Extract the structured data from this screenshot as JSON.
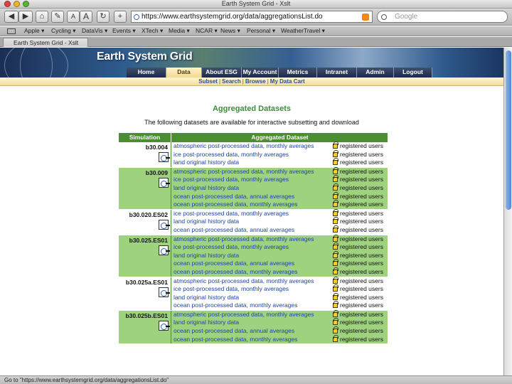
{
  "window": {
    "title": "Earth System Grid - Xslt"
  },
  "toolbar": {
    "back": "◀",
    "forward": "▶",
    "home": "⌂",
    "edit": "✎",
    "font_smaller": "A",
    "font_larger": "A",
    "reload": "↻",
    "add": "+",
    "url": "https://www.earthsystemgrid.org/data/aggregationsList.do",
    "search_placeholder": "Google"
  },
  "bookmarks": [
    "Apple ▾",
    "Cycling ▾",
    "DataVis ▾",
    "Events ▾",
    "XTech ▾",
    "Media ▾",
    "NCAR ▾",
    "News ▾",
    "Personal ▾",
    "WeatherTravel ▾"
  ],
  "tab": {
    "label": "Earth System Grid - Xslt"
  },
  "site": {
    "banner_title": "Earth System Grid",
    "nav": [
      "Home",
      "Data",
      "About ESG",
      "My Account",
      "Metrics",
      "Intranet",
      "Admin",
      "Logout"
    ],
    "active_nav": "Data",
    "subnav": [
      "Subset",
      "Search",
      "Browse",
      "My Data Cart"
    ],
    "subnav_sep": "|"
  },
  "main": {
    "heading": "Aggregated Datasets",
    "intro": "The following datasets are available for interactive subsetting and download",
    "columns": [
      "Simulation",
      "Aggregated Dataset"
    ],
    "rows": [
      {
        "simulation": "b30.004",
        "datasets": [
          {
            "label": "atmospheric post-processed data, monthly averages",
            "access": "registered users"
          },
          {
            "label": "ice post-processed data, monthly averages",
            "access": "registered users"
          },
          {
            "label": "land original history data",
            "access": "registered users"
          }
        ]
      },
      {
        "simulation": "b30.009",
        "datasets": [
          {
            "label": "atmospheric post-processed data, monthly averages",
            "access": "registered users"
          },
          {
            "label": "ice post-processed data, monthly averages",
            "access": "registered users"
          },
          {
            "label": "land original history data",
            "access": "registered users"
          },
          {
            "label": "ocean post-processed data, annual averages",
            "access": "registered users"
          },
          {
            "label": "ocean post-processed data, monthly averages",
            "access": "registered users"
          }
        ]
      },
      {
        "simulation": "b30.020.ES02",
        "datasets": [
          {
            "label": "ice post-processed data, monthly averages",
            "access": "registered users"
          },
          {
            "label": "land original history data",
            "access": "registered users"
          },
          {
            "label": "ocean post-processed data, annual averages",
            "access": "registered users"
          }
        ]
      },
      {
        "simulation": "b30.025.ES01",
        "datasets": [
          {
            "label": "atmospheric post-processed data, monthly averages",
            "access": "registered users"
          },
          {
            "label": "ice post-processed data, monthly averages",
            "access": "registered users"
          },
          {
            "label": "land original history data",
            "access": "registered users"
          },
          {
            "label": "ocean post-processed data, annual averages",
            "access": "registered users"
          },
          {
            "label": "ocean post-processed data, monthly averages",
            "access": "registered users"
          }
        ]
      },
      {
        "simulation": "b30.025a.ES01",
        "datasets": [
          {
            "label": "atmospheric post-processed data, monthly averages",
            "access": "registered users"
          },
          {
            "label": "ice post-processed data, monthly averages",
            "access": "registered users"
          },
          {
            "label": "land original history data",
            "access": "registered users"
          },
          {
            "label": "ocean post-processed data, monthly averages",
            "access": "registered users"
          }
        ]
      },
      {
        "simulation": "b30.025b.ES01",
        "datasets": [
          {
            "label": "atmospheric post-processed data, monthly averages",
            "access": "registered users"
          },
          {
            "label": "land original history data",
            "access": "registered users"
          },
          {
            "label": "ocean post-processed data, annual averages",
            "access": "registered users"
          },
          {
            "label": "ocean post-processed data, monthly averages",
            "access": "registered users"
          }
        ]
      }
    ]
  },
  "status": {
    "text": "Go to \"https://www.earthsystemgrid.org/data/aggregationsList.do\""
  },
  "colors": {
    "header_green": "#4a8e2f",
    "row_green": "#9fd27f",
    "link_blue": "#1c44a8",
    "heading_green": "#3b8f3b"
  }
}
